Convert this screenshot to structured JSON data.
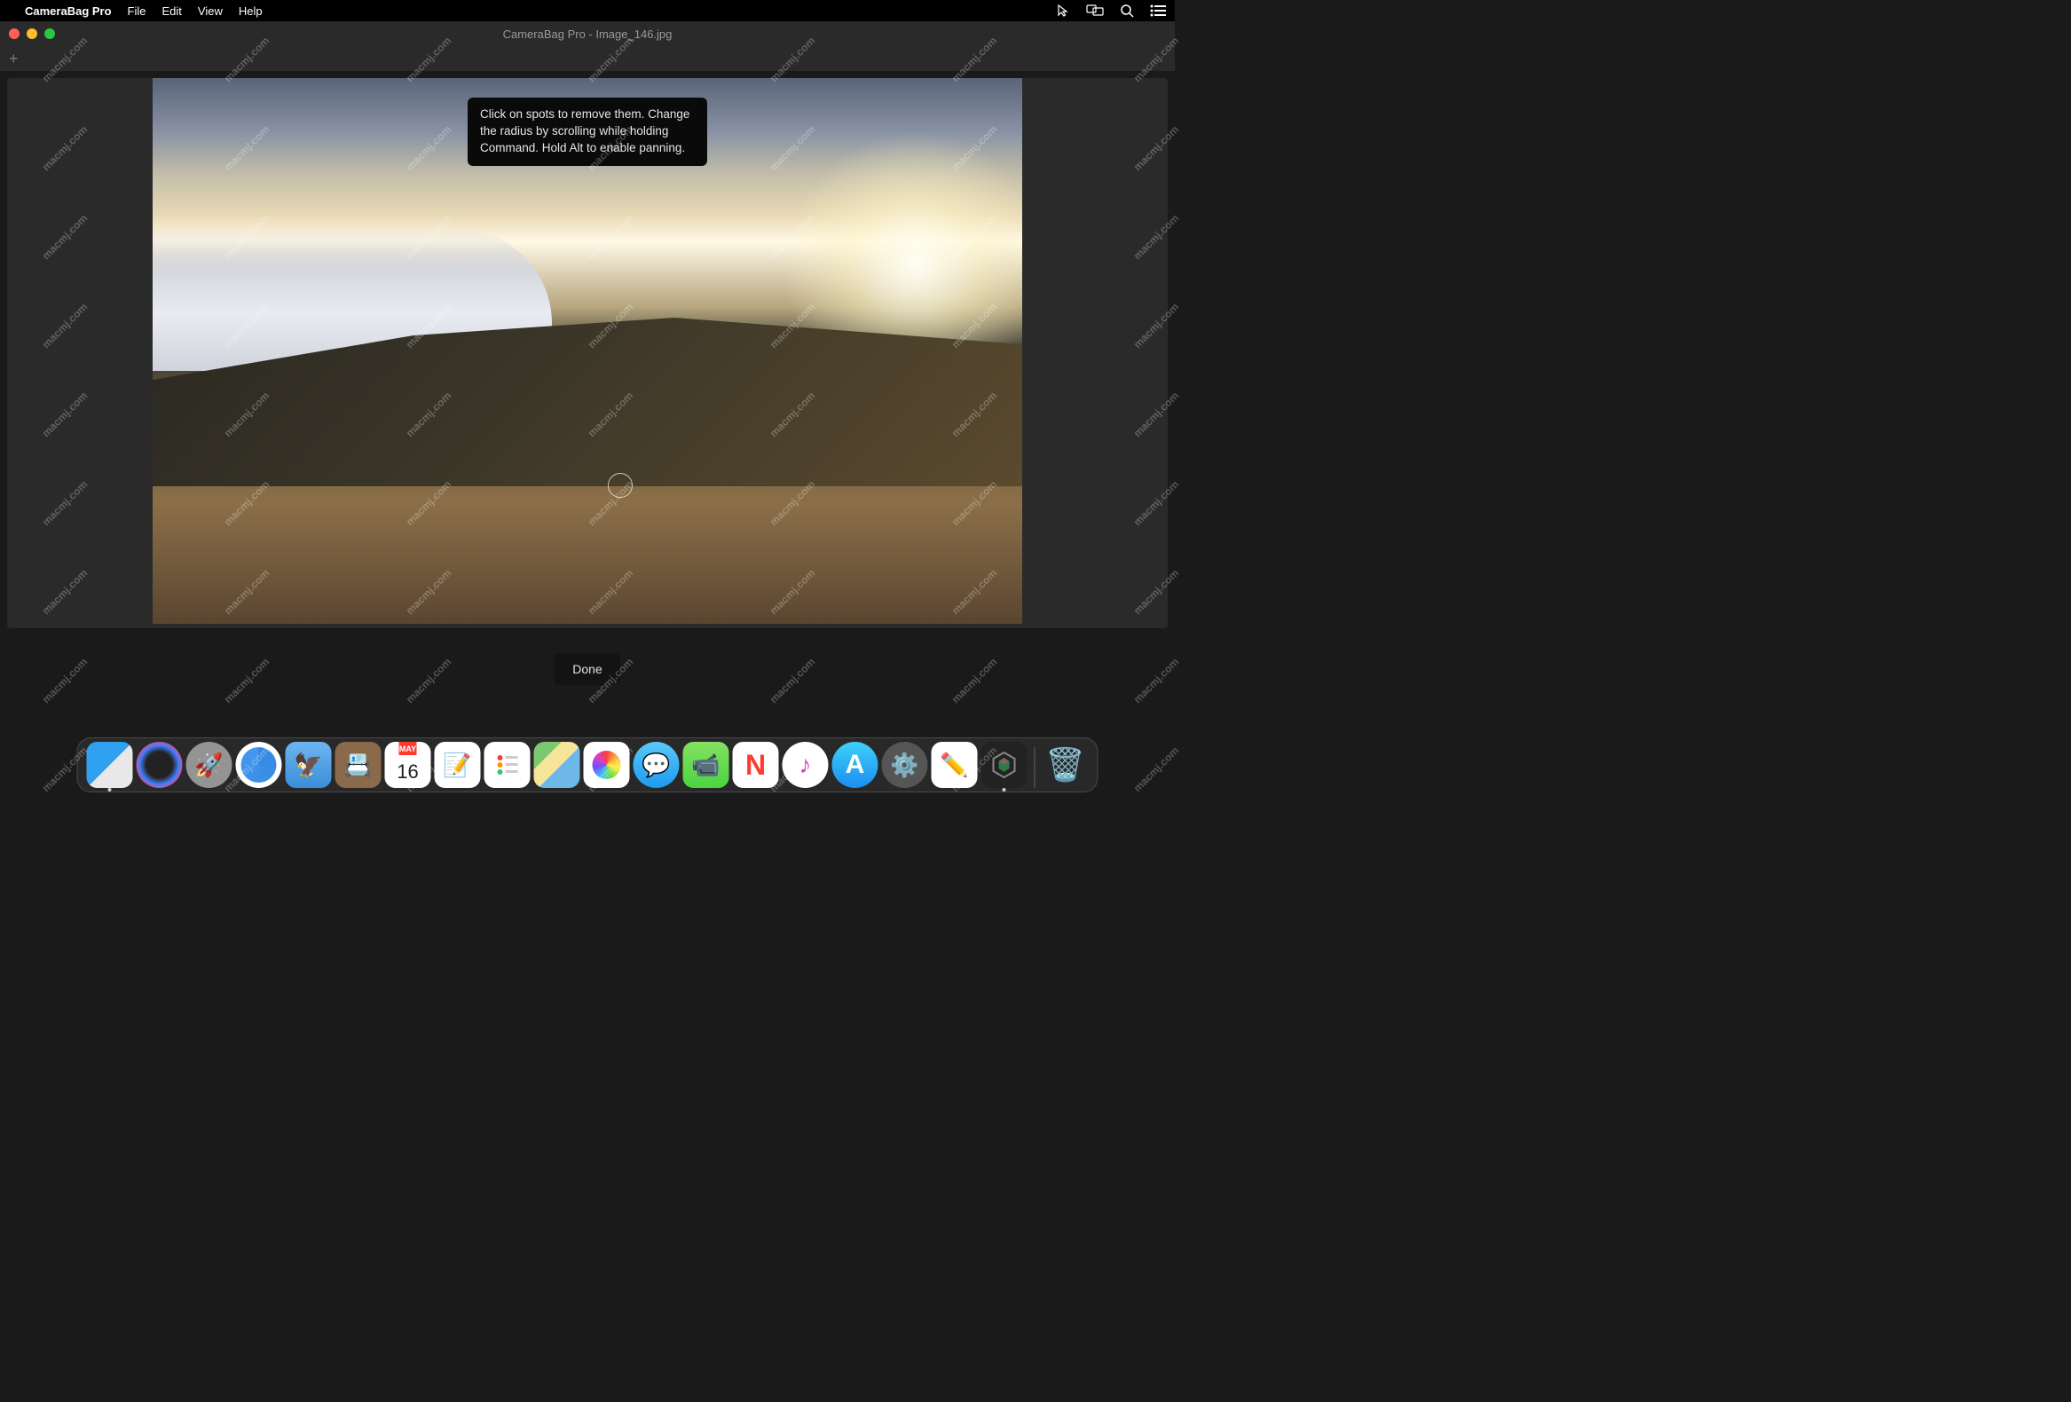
{
  "menubar": {
    "app_name": "CameraBag Pro",
    "items": [
      "File",
      "Edit",
      "View",
      "Help"
    ]
  },
  "window": {
    "title": "CameraBag Pro - Image_146.jpg"
  },
  "tooltip": {
    "text": "Click on spots to remove them. Change the radius by scrolling while holding Command. Hold Alt to enable panning."
  },
  "buttons": {
    "done": "Done"
  },
  "calendar": {
    "month": "MAY",
    "day": "16"
  },
  "dock": {
    "items": [
      "finder",
      "siri",
      "launchpad",
      "safari",
      "mail",
      "contacts",
      "calendar",
      "notes",
      "reminders",
      "maps",
      "photos",
      "messages",
      "facetime",
      "news",
      "music",
      "appstore",
      "sysprefs",
      "textedit",
      "camerabag"
    ],
    "trash": "trash"
  },
  "watermark_text": "macmj.com"
}
